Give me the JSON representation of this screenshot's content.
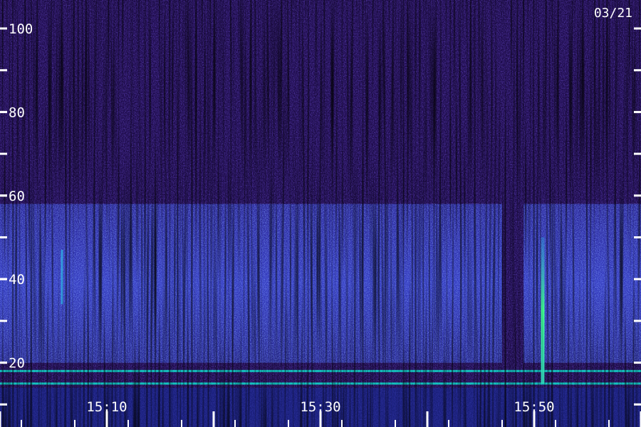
{
  "date_label": "03/21",
  "colors": {
    "background_low": "#1a0840",
    "background_mid": "#2a1a90",
    "band_high": "#3a55e8",
    "signal_cyan": "#10e0d0",
    "signal_green": "#40ff90",
    "tick": "#ffffff"
  },
  "chart_data": {
    "type": "heatmap",
    "title": "",
    "xlabel": "",
    "ylabel": "",
    "x_ticks": [
      "15:10",
      "15:30",
      "15:50"
    ],
    "y_ticks": [
      "20",
      "40",
      "60",
      "80",
      "100"
    ],
    "xlim": [
      "15:02",
      "15:62"
    ],
    "ylim": [
      0,
      107
    ],
    "grid": false,
    "features": [
      {
        "name": "",
        "kind": "broadband-band",
        "y_range": [
          20,
          58
        ],
        "x_range": [
          "15:00",
          "15:47"
        ],
        "intensity": "medium"
      },
      {
        "name": "",
        "kind": "broadband-band",
        "y_range": [
          20,
          58
        ],
        "x_range": [
          "15:49",
          "15:60"
        ],
        "intensity": "medium"
      },
      {
        "name": "",
        "kind": "narrowband-line",
        "y": 18,
        "intensity": "high"
      },
      {
        "name": "",
        "kind": "narrowband-line",
        "y": 15,
        "intensity": "high"
      },
      {
        "name": "",
        "kind": "burst",
        "x": "15:50.8",
        "y_range": [
          15,
          50
        ],
        "intensity": "very-high"
      },
      {
        "name": "",
        "kind": "burst",
        "x": "15:05.8",
        "y_range": [
          34,
          47
        ],
        "intensity": "medium"
      }
    ]
  }
}
